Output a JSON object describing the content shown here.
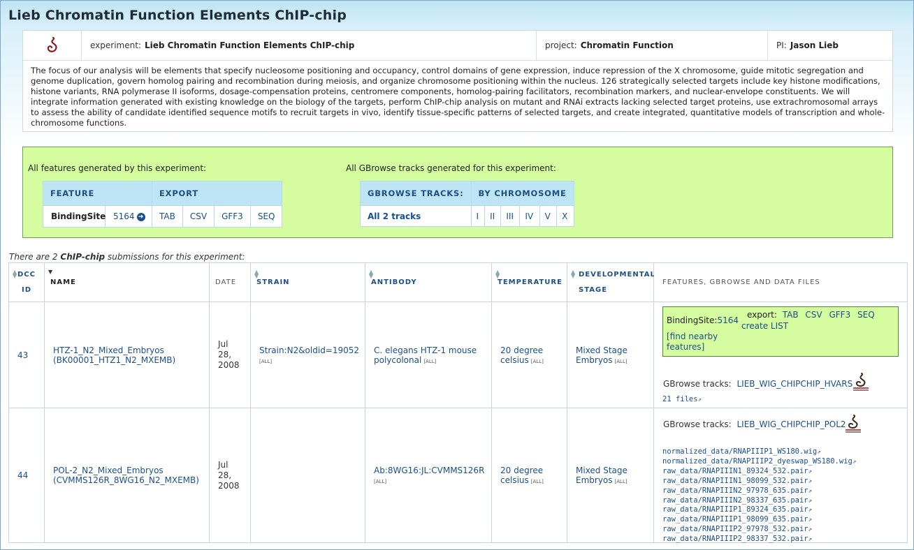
{
  "page": {
    "title": "Lieb Chromatin Function Elements ChIP-chip"
  },
  "info": {
    "experiment_label": "experiment:",
    "experiment_value": "Lieb Chromatin Function Elements ChIP-chip",
    "project_label": "project:",
    "project_value": "Chromatin Function",
    "pi_label": "PI:",
    "pi_value": "Jason Lieb",
    "description": "The focus of our analysis will be elements that specify nucleosome positioning and occupancy, control domains of gene expression, induce repression of the X chromosome, guide mitotic segregation and genome duplication, govern homolog pairing and recombination during meiosis, and organize chromosome positioning within the nucleus. 126 strategically selected targets include key histone modifications, histone variants, RNA polymerase II isoforms, dosage-compensation proteins, centromere components, homolog-pairing facilitators, recombination markers, and nuclear-envelope constituents. We will integrate information generated with existing knowledge on the biology of the targets, perform ChIP-chip analysis on mutant and RNAi extracts lacking selected target proteins, use extrachromosomal arrays to assess the ability of candidate identified sequence motifs to recruit targets in vivo, identify tissue-specific patterns of selected targets, and create integrated, quantitative models of transcription and whole-chromosome functions."
  },
  "features": {
    "label": "All features generated by this experiment:",
    "col_feature": "FEATURE",
    "col_export": "EXPORT",
    "feature_name": "BindingSite",
    "feature_count": "5164",
    "exports": [
      "TAB",
      "CSV",
      "GFF3",
      "SEQ"
    ]
  },
  "gbrowse": {
    "label": "All GBrowse tracks generated for this experiment:",
    "col_tracks": "GBROWSE TRACKS:",
    "col_chrom": "BY CHROMOSOME",
    "all_tracks": "All 2 tracks",
    "chromosomes": [
      "I",
      "II",
      "III",
      "IV",
      "V",
      "X"
    ]
  },
  "submissions": {
    "caption_pre": "There are 2",
    "caption_bold": "ChIP-chip",
    "caption_post": "submissions for this experiment:",
    "columns": {
      "dcc_id_1": "DCC",
      "dcc_id_2": "ID",
      "name": "NAME",
      "date": "DATE",
      "strain": "STRAIN",
      "antibody": "ANTIBODY",
      "temperature": "TEMPERATURE",
      "stage_1": "DEVELOPMENTAL",
      "stage_2": "STAGE",
      "files": "FEATURES, GBROWSE AND DATA FILES"
    },
    "all_note": "[ALL]",
    "rows": [
      {
        "id": "43",
        "name_1": "HTZ-1_N2_Mixed_Embryos",
        "name_2": "(BK00001_HTZ1_N2_MXEMB)",
        "date_1": "Jul",
        "date_2": "28,",
        "date_3": "2008",
        "strain": "Strain:N2&oldid=19052",
        "antibody_1": "C. elegans HTZ-1 mouse",
        "antibody_2": "polycolonal",
        "temp_1": "20 degree",
        "temp_2": "celsius",
        "stage_1": "Mixed Stage",
        "stage_2": "Embryos",
        "feature_label": "BindingSite:",
        "feature_count": "5164",
        "export_label": "export:",
        "exports": [
          "TAB",
          "CSV",
          "GFF3",
          "SEQ"
        ],
        "create_list": "create LIST",
        "find_nearby_1": "[find nearby",
        "find_nearby_2": "features]",
        "gbrowse_label": "GBrowse tracks:",
        "gbrowse_track": "LIEB_WIG_CHIPCHIP_HVARS",
        "files_link": "21 files"
      },
      {
        "id": "44",
        "name_1": "POL-2_N2_Mixed_Embryos",
        "name_2": "(CVMMS126R_8WG16_N2_MXEMB)",
        "date_1": "Jul",
        "date_2": "28,",
        "date_3": "2008",
        "antibody_1": "Ab:8WG16:JL:CVMMS126R",
        "temp_1": "20 degree",
        "temp_2": "celsius",
        "stage_1": "Mixed Stage",
        "stage_2": "Embryos",
        "gbrowse_label": "GBrowse tracks:",
        "gbrowse_track": "LIEB_WIG_CHIPCHIP_POL2",
        "files": [
          "normalized_data/RNAPIIIP1_WS180.wig",
          "normalized_data/RNAPIIIP2_dyeswap_WS180.wig",
          "raw_data/RNAPIIIN1_89324_532.pair",
          "raw_data/RNAPIIIN1_98099_532.pair",
          "raw_data/RNAPIIIN2_97978_635.pair",
          "raw_data/RNAPIIIN2_98337_635.pair",
          "raw_data/RNAPIIIP1_89324_635.pair",
          "raw_data/RNAPIIIP1_98099_635.pair",
          "raw_data/RNAPIIIP2_97978_532.pair",
          "raw_data/RNAPIIIP2_98337_532.pair"
        ]
      }
    ]
  },
  "icons": {
    "logo": "worm-logo-icon",
    "external": "external-link-icon",
    "arrow": "arrow-right-circle-icon"
  },
  "colors": {
    "link": "#1a4f8f",
    "green_box": "#d5fc9e",
    "header_blue": "#bee5f6"
  }
}
